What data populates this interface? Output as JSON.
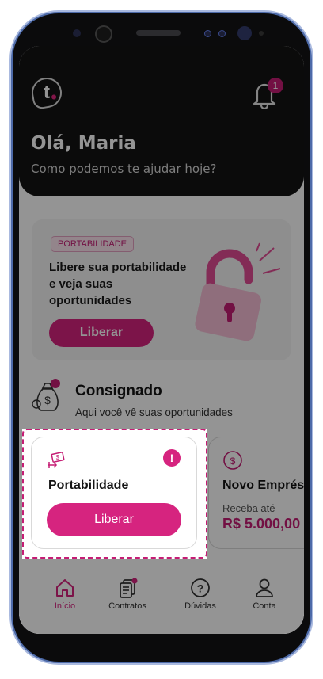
{
  "header": {
    "notification_count": "1",
    "greeting": "Olá, Maria",
    "subtitle": "Como podemos te ajudar hoje?",
    "logo_letter": "t"
  },
  "promo": {
    "tag": "PORTABILIDADE",
    "text": "Libere sua portabilidade e veja suas oportunidades",
    "button": "Liberar"
  },
  "consignado": {
    "title": "Consignado",
    "subtitle": "Aqui você vê suas oportunidades"
  },
  "cards": {
    "portabilidade": {
      "title": "Portabilidade",
      "alert": "!",
      "button": "Liberar"
    },
    "novo_emprestimo": {
      "title": "Novo Empréstimo",
      "subtitle": "Receba até",
      "value": "R$ 5.000,00"
    }
  },
  "nav": {
    "items": [
      {
        "label": "Início",
        "icon": "home-icon",
        "active": true
      },
      {
        "label": "Contratos",
        "icon": "contracts-icon",
        "active": false
      },
      {
        "label": "Dúvidas",
        "icon": "help-icon",
        "active": false
      },
      {
        "label": "Conta",
        "icon": "account-icon",
        "active": false
      }
    ]
  },
  "colors": {
    "accent": "#d6247f",
    "header_bg": "#141414",
    "overlay": "rgba(0,0,0,0.42)"
  }
}
